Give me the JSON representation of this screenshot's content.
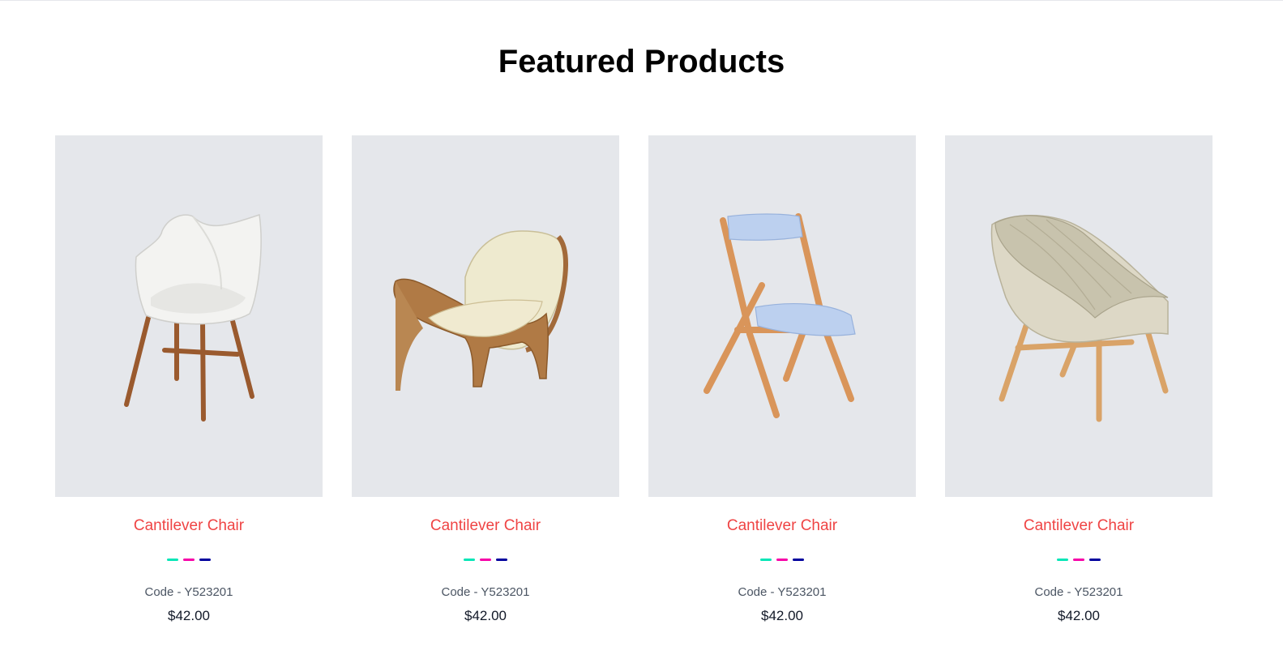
{
  "section": {
    "title": "Featured Products"
  },
  "products": [
    {
      "image_icon": "white-shell-chair-image",
      "name": "Cantilever Chair",
      "code": "Code - Y523201",
      "price": "$42.00",
      "colors": [
        "#05E6B7",
        "#F701A8",
        "#00009D"
      ]
    },
    {
      "image_icon": "wood-shell-lounge-chair-image",
      "name": "Cantilever Chair",
      "code": "Code - Y523201",
      "price": "$42.00",
      "colors": [
        "#05E6B7",
        "#F701A8",
        "#00009D"
      ]
    },
    {
      "image_icon": "folding-padded-chair-image",
      "name": "Cantilever Chair",
      "code": "Code - Y523201",
      "price": "$42.00",
      "colors": [
        "#05E6B7",
        "#F701A8",
        "#00009D"
      ]
    },
    {
      "image_icon": "woven-lounge-chair-image",
      "name": "Cantilever Chair",
      "code": "Code - Y523201",
      "price": "$42.00",
      "colors": [
        "#05E6B7",
        "#F701A8",
        "#00009D"
      ]
    }
  ]
}
